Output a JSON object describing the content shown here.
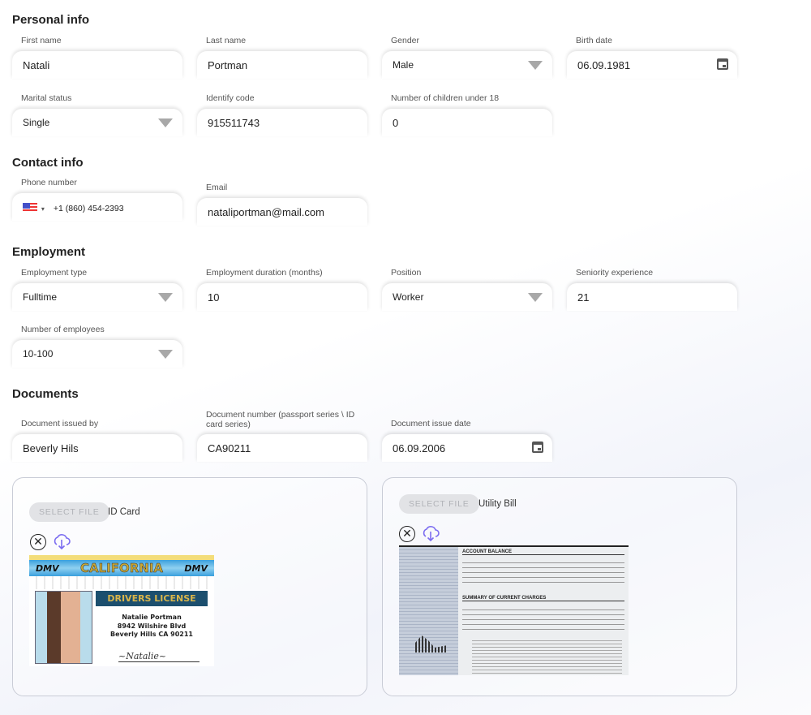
{
  "personal": {
    "title": "Personal info",
    "first_name": {
      "label": "First name",
      "value": "Natali"
    },
    "last_name": {
      "label": "Last name",
      "value": "Portman"
    },
    "gender": {
      "label": "Gender",
      "value": "Male"
    },
    "birth_date": {
      "label": "Birth date",
      "value": "06.09.1981"
    },
    "marital": {
      "label": "Marital status",
      "value": "Single"
    },
    "identify": {
      "label": "Identify code",
      "value": "915511743"
    },
    "children": {
      "label": "Number of children under 18",
      "value": "0"
    }
  },
  "contact": {
    "title": "Contact info",
    "phone": {
      "label": "Phone number",
      "value": "+1 (860) 454-2393",
      "country_icon": "us-flag-icon"
    },
    "email": {
      "label": "Email",
      "value": "nataliportman@mail.com"
    }
  },
  "employment": {
    "title": "Employment",
    "type": {
      "label": "Employment type",
      "value": "Fulltime"
    },
    "duration": {
      "label": "Employment duration (months)",
      "value": "10"
    },
    "position": {
      "label": "Position",
      "value": "Worker"
    },
    "seniority": {
      "label": "Seniority experience",
      "value": "21"
    },
    "employees": {
      "label": "Number of employees",
      "value": "10-100"
    }
  },
  "documents": {
    "title": "Documents",
    "issued_by": {
      "label": "Document issued by",
      "value": "Beverly Hils"
    },
    "number": {
      "label": "Document number (passport series \\ ID card series)",
      "value": "CA90211"
    },
    "issue_date": {
      "label": "Document issue date",
      "value": "06.09.2006"
    },
    "files": [
      {
        "button": "SELECT FILE",
        "label": "ID Card"
      },
      {
        "button": "SELECT FILE",
        "label": "Utility Bill"
      }
    ],
    "id_card_image": {
      "header": "CALIFORNIA",
      "dmv": "DMV",
      "title": "DRIVERS LICENSE",
      "name": "Natalie Portman",
      "address1": "8942 Wilshire Blvd",
      "address2": "Beverly Hills CA 90211"
    },
    "bill_image": {
      "heading1": "ACCOUNT BALANCE",
      "heading2": "SUMMARY OF CURRENT CHARGES"
    }
  },
  "colors": {
    "accent": "#7b6cf0",
    "select_button_bg": "#e2e3e6"
  }
}
